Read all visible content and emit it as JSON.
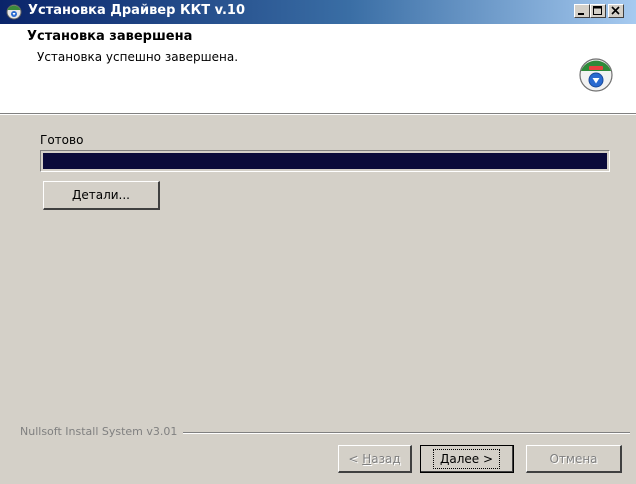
{
  "window": {
    "title": "Установка Драйвер ККТ v.10",
    "title_icon": "installer-disc-icon",
    "controls": [
      "minimize-icon",
      "maximize-icon",
      "close-icon"
    ]
  },
  "header": {
    "title": "Установка завершена",
    "subtitle": "Установка успешно завершена.",
    "icon": "installer-disc-icon"
  },
  "body": {
    "status_label": "Готово",
    "progress": 1.0,
    "details_button": {
      "prefix": "",
      "mnemonic": "Д",
      "rest": "етали..."
    }
  },
  "footer": {
    "brand": "Nullsoft Install System v3.01",
    "back_button": {
      "prefix": "< ",
      "mnemonic": "Н",
      "rest": "азад",
      "enabled": false
    },
    "next_button": {
      "prefix": "",
      "mnemonic": "Д",
      "rest": "алее >",
      "enabled": true
    },
    "cancel_button": {
      "label": "Отмена",
      "enabled": false
    }
  },
  "colors": {
    "face": "#d4d0c8",
    "titlebar_start": "#0a246a",
    "titlebar_end": "#a6caf0",
    "progress_fill": "#0a0a3a"
  }
}
